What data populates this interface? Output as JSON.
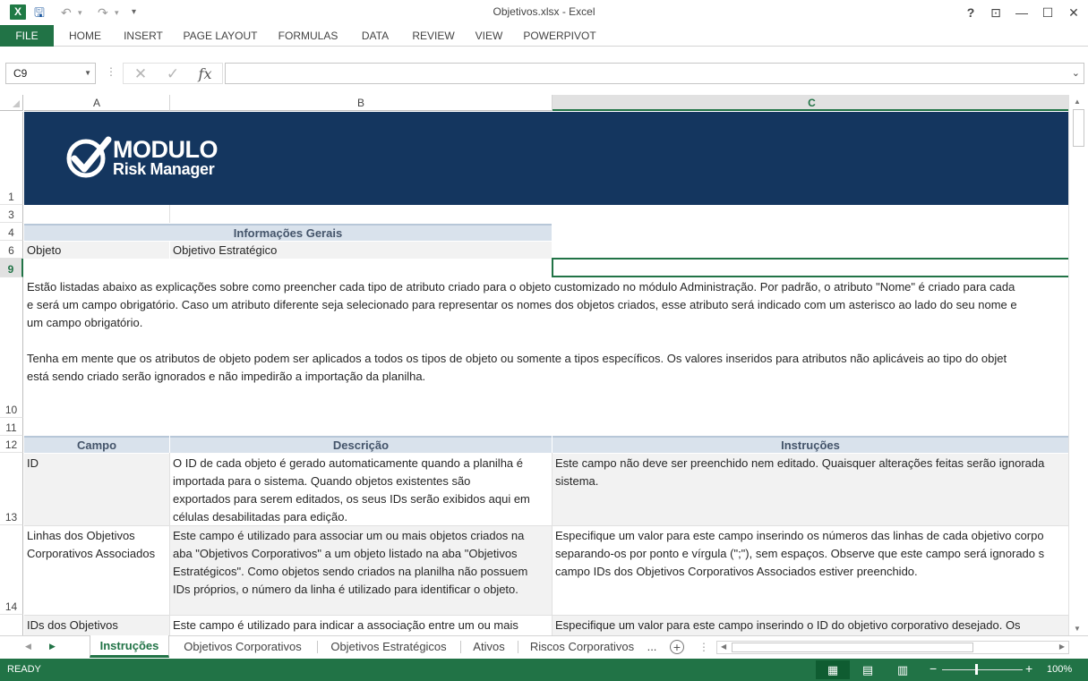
{
  "window": {
    "title": "Objetivos.xlsx - Excel",
    "app_icon_letter": "X",
    "help": "?",
    "restore_ribbon": "⊡",
    "minimize": "—",
    "maximize": "☐",
    "close": "✕"
  },
  "qat": {
    "save": "🖫",
    "undo": "↶",
    "redo": "↷",
    "customize": "▾"
  },
  "ribbon": {
    "tabs": [
      "FILE",
      "HOME",
      "INSERT",
      "PAGE LAYOUT",
      "FORMULAS",
      "DATA",
      "REVIEW",
      "VIEW",
      "POWERPIVOT"
    ]
  },
  "formula_bar": {
    "name_box": "C9",
    "cancel_glyph": "✕",
    "enter_glyph": "✓",
    "fx_glyph": "fx",
    "formula": ""
  },
  "columns": [
    "A",
    "B",
    "C"
  ],
  "selected_column": "C",
  "rows": [
    "1",
    "3",
    "4",
    "6",
    "9",
    "10",
    "11",
    "12",
    "13",
    "14",
    ""
  ],
  "selected_row": "9",
  "logo": {
    "line1": "MODULO",
    "line2": "Risk Manager"
  },
  "info": {
    "header": "Informações Gerais",
    "label": "Objeto",
    "value": "Objetivo Estratégico"
  },
  "intro": {
    "p1_l1": "Estão listadas abaixo as explicações sobre como preencher cada tipo de atributo criado para o objeto customizado no módulo Administração. Por padrão, o atributo \"Nome\" é criado para cada",
    "p1_l2": "e será um campo obrigatório. Caso um atributo diferente seja selecionado para representar os nomes dos objetos criados, esse atributo será indicado com um asterisco ao lado do seu nome e",
    "p1_l3": "um campo obrigatório.",
    "p2_l1": "Tenha em mente que os atributos de objeto podem ser aplicados a todos os tipos de objeto ou somente a tipos específicos. Os valores inseridos para atributos não aplicáveis ao tipo do objet",
    "p2_l2": "está sendo criado serão ignorados e não impedirão a importação da planilha."
  },
  "table": {
    "headers": [
      "Campo",
      "Descrição",
      "Instruções"
    ],
    "rows": [
      {
        "campo": [
          "ID"
        ],
        "descricao": [
          "O ID de cada objeto é gerado automaticamente quando a planilha é",
          "importada para o sistema. Quando objetos existentes são",
          "exportados para serem editados, os seus IDs serão exibidos aqui em",
          "células desabilitadas para edição."
        ],
        "instrucoes": [
          "Este campo não deve ser preenchido nem editado. Quaisquer alterações feitas serão ignorada",
          "sistema."
        ]
      },
      {
        "campo": [
          "Linhas dos Objetivos",
          "Corporativos Associados"
        ],
        "descricao": [
          "Este campo é utilizado para associar um ou mais objetos criados na",
          "aba \"Objetivos Corporativos\" a um objeto listado na aba \"Objetivos",
          "Estratégicos\". Como objetos sendo criados na planilha não possuem",
          "IDs próprios, o número da linha é utilizado para identificar o objeto."
        ],
        "instrucoes": [
          "Especifique um valor para este campo inserindo os números das linhas de cada objetivo corpo",
          "separando-os por ponto e vírgula (\";\"), sem espaços. Observe que este campo será ignorado s",
          "campo IDs dos Objetivos Corporativos Associados estiver preenchido."
        ]
      },
      {
        "campo": [
          "IDs dos Objetivos"
        ],
        "descricao": [
          "Este campo é utilizado para indicar a associação entre um ou mais"
        ],
        "instrucoes": [
          "Especifique um valor para este campo inserindo o ID do objetivo corporativo desejado. Os"
        ]
      }
    ]
  },
  "sheets": {
    "tabs": [
      "Instruções",
      "Objetivos Corporativos",
      "Objetivos Estratégicos",
      "Ativos",
      "Riscos Corporativos"
    ],
    "more": "...",
    "add": "+"
  },
  "status": {
    "ready": "READY",
    "zoom": "100%",
    "zoom_minus": "−",
    "zoom_plus": "+",
    "view_normal": "▦",
    "view_layout": "▤",
    "view_break": "▥"
  }
}
